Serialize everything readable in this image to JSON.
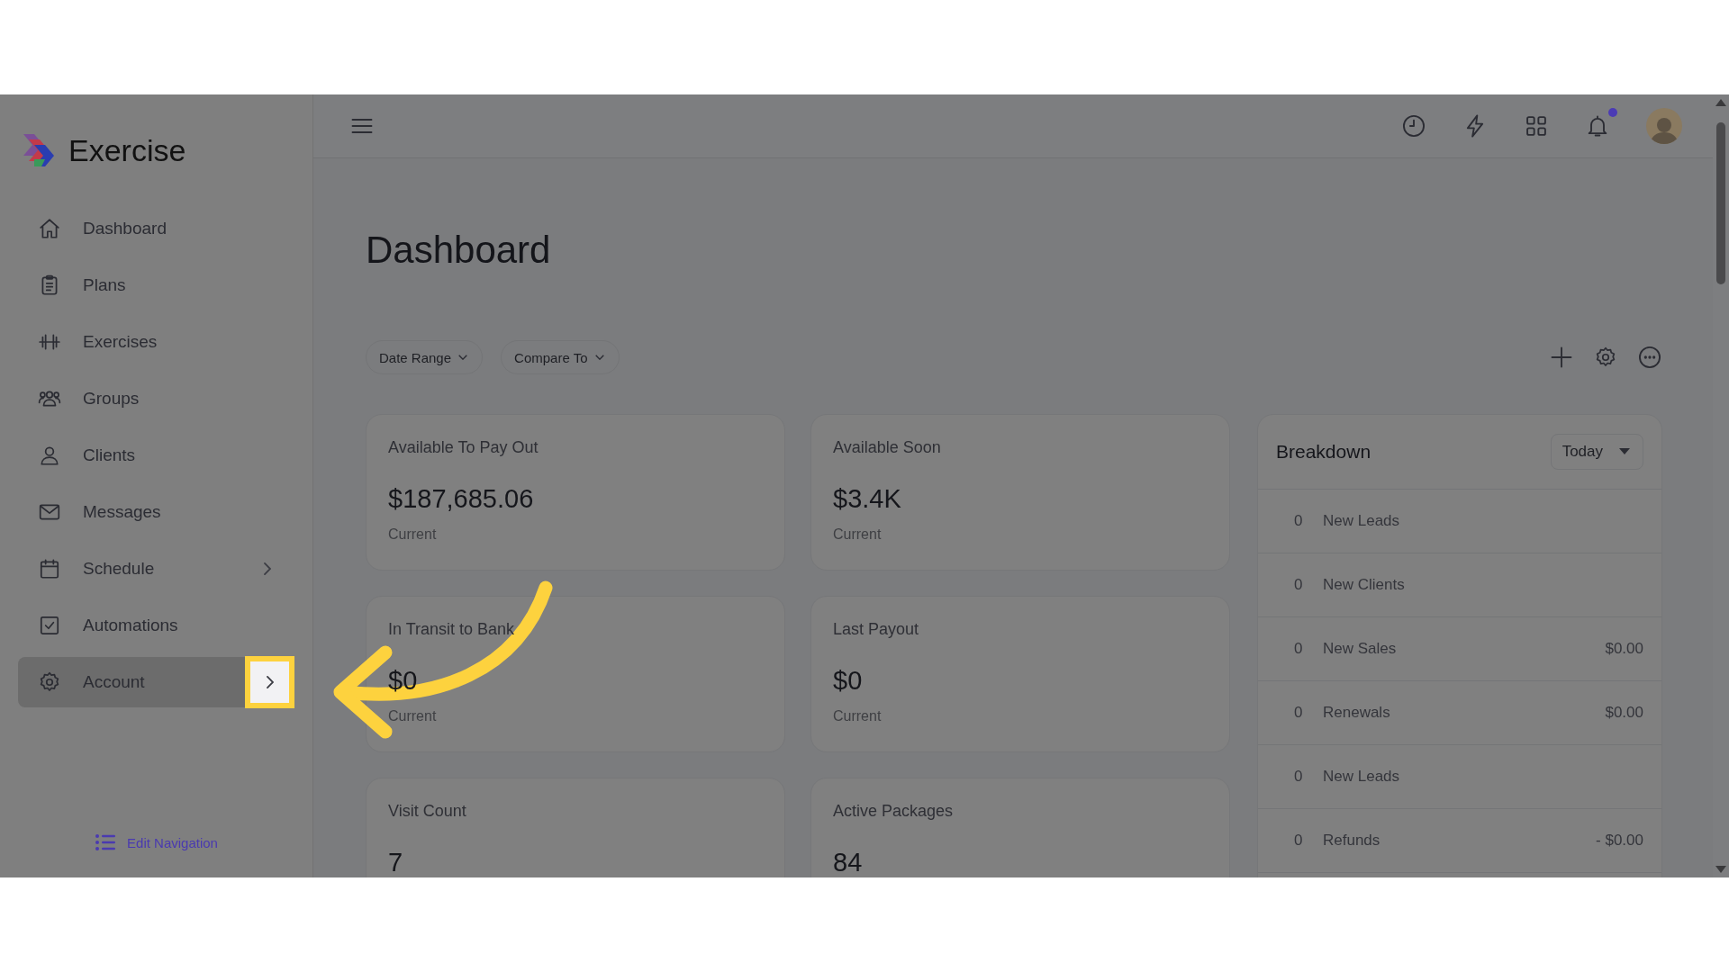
{
  "brand": {
    "name": "Exercise"
  },
  "sidebar": {
    "items": [
      {
        "label": "Dashboard",
        "selected": false,
        "expandable": false,
        "highlighted": false
      },
      {
        "label": "Plans",
        "selected": false,
        "expandable": false,
        "highlighted": false
      },
      {
        "label": "Exercises",
        "selected": false,
        "expandable": false,
        "highlighted": false
      },
      {
        "label": "Groups",
        "selected": false,
        "expandable": false,
        "highlighted": false
      },
      {
        "label": "Clients",
        "selected": false,
        "expandable": false,
        "highlighted": false
      },
      {
        "label": "Messages",
        "selected": false,
        "expandable": false,
        "highlighted": false
      },
      {
        "label": "Schedule",
        "selected": false,
        "expandable": true,
        "highlighted": false
      },
      {
        "label": "Automations",
        "selected": false,
        "expandable": false,
        "highlighted": false
      },
      {
        "label": "Account",
        "selected": true,
        "expandable": true,
        "highlighted": true
      }
    ],
    "edit_link": "Edit Navigation"
  },
  "header": {
    "notifications_unread": true
  },
  "page": {
    "title": "Dashboard",
    "filters": [
      "Date Range",
      "Compare To"
    ],
    "cards": [
      {
        "title": "Available To Pay Out",
        "value": "$187,685.06",
        "note": "Current"
      },
      {
        "title": "Available Soon",
        "value": "$3.4K",
        "note": "Current"
      },
      {
        "title": "In Transit to Bank",
        "value": "$0",
        "note": "Current"
      },
      {
        "title": "Last Payout",
        "value": "$0",
        "note": "Current"
      },
      {
        "title": "Visit Count",
        "value": "7"
      },
      {
        "title": "Active Packages",
        "value": "84"
      }
    ],
    "breakdown": {
      "title": "Breakdown",
      "period": "Today",
      "rows": [
        {
          "count": "0",
          "label": "New Leads"
        },
        {
          "count": "0",
          "label": "New Clients"
        },
        {
          "count": "0",
          "label": "New Sales",
          "amount": "$0.00"
        },
        {
          "count": "0",
          "label": "Renewals",
          "amount": "$0.00"
        },
        {
          "count": "0",
          "label": "New Leads"
        },
        {
          "count": "0",
          "label": "Refunds",
          "amount": "- $0.00"
        }
      ]
    }
  }
}
